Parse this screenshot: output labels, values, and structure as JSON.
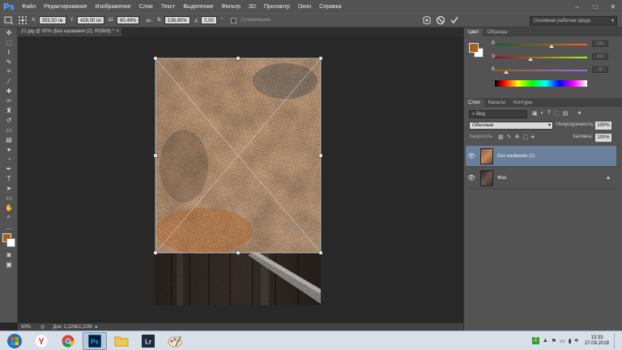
{
  "app": {
    "logo": "Ps"
  },
  "menu": [
    "Файл",
    "Редактирование",
    "Изображение",
    "Слои",
    "Текст",
    "Выделение",
    "Фильтр",
    "3D",
    "Просмотр",
    "Окно",
    "Справка"
  ],
  "window_controls": {
    "minimize": "–",
    "maximize": "□",
    "close": "✕"
  },
  "options": {
    "x_label": "X:",
    "x_value": "359,50 пк",
    "y_label": "Y:",
    "y_value": "428,00 пк",
    "w_label": "Ш:",
    "w_value": "80,49%",
    "h_label": "В:",
    "h_value": "136,60%",
    "angle_label": "∠",
    "angle_value": "0,00",
    "angle_unit": "°",
    "smoothing_label": "Сглаживание",
    "workspace": "Основная рабочая среда"
  },
  "document": {
    "tab_title": "21.jpg @ 50% (Без названия (2), RGB/8) *"
  },
  "status": {
    "zoom": "50%",
    "doc_info": "Док: 2,22M/2,22M"
  },
  "color_panel": {
    "tabs": [
      "Цвет",
      "Образцы"
    ],
    "foreground": "#a8601c",
    "background": "#ffffff",
    "r_label": "R",
    "r_value": "155",
    "g_label": "G",
    "g_value": "100",
    "b_label": "B",
    "b_value": "30",
    "r_level": 0.61,
    "g_level": 0.39,
    "b_level": 0.12
  },
  "layers_panel": {
    "tabs": [
      "Слои",
      "Каналы",
      "Контуры"
    ],
    "filter_label": "Вид",
    "blend_mode": "Обычные",
    "opacity_label": "Непрозрачность:",
    "opacity_value": "100%",
    "lock_label": "Закрепить:",
    "fill_label": "Заливка:",
    "fill_value": "100%",
    "layers": [
      {
        "name": "Без названия (2)",
        "selected": true
      },
      {
        "name": "Фон",
        "selected": false,
        "locked": true
      }
    ],
    "footer_icons": [
      "link-icon",
      "fx-icon",
      "mask-icon",
      "adjustment-icon",
      "folder-icon",
      "new-layer-icon",
      "trash-icon"
    ]
  },
  "taskbar": {
    "clock_time": "13:33",
    "clock_date": "27.09.2018",
    "apps": [
      "start",
      "yandex",
      "chrome",
      "photoshop",
      "explorer",
      "lightroom",
      "paint"
    ]
  }
}
